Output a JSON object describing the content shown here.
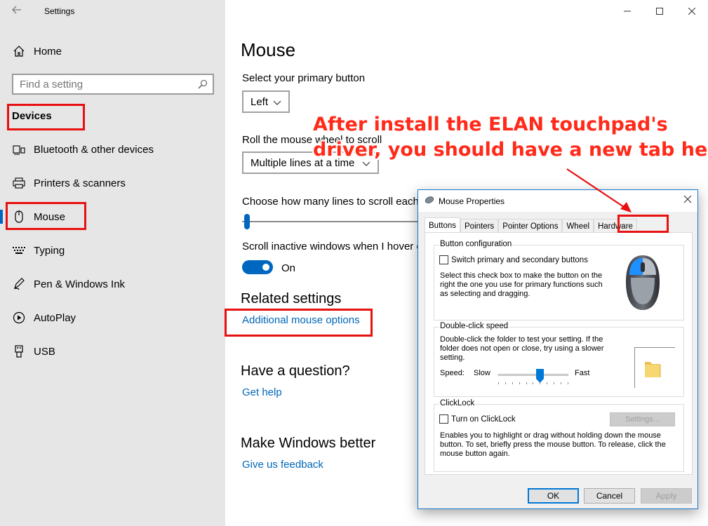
{
  "window": {
    "app_title": "Settings",
    "controls": [
      "minimize",
      "maximize",
      "close"
    ]
  },
  "sidebar": {
    "home_label": "Home",
    "search_placeholder": "Find a setting",
    "section_title": "Devices",
    "items": [
      {
        "label": "Bluetooth & other devices",
        "icon": "bluetooth-icon"
      },
      {
        "label": "Printers & scanners",
        "icon": "printer-icon"
      },
      {
        "label": "Mouse",
        "icon": "mouse-icon",
        "selected": true
      },
      {
        "label": "Typing",
        "icon": "keyboard-icon"
      },
      {
        "label": "Pen & Windows Ink",
        "icon": "pen-icon"
      },
      {
        "label": "AutoPlay",
        "icon": "autoplay-icon"
      },
      {
        "label": "USB",
        "icon": "usb-icon"
      }
    ]
  },
  "main": {
    "title": "Mouse",
    "primary_button_label": "Select your primary button",
    "primary_button_value": "Left",
    "scroll_label": "Roll the mouse wheel to scroll",
    "scroll_value": "Multiple lines at a time",
    "lines_label": "Choose how many lines to scroll each time",
    "inactive_label": "Scroll inactive windows when I hover over them",
    "toggle_state": "On",
    "related_title": "Related settings",
    "related_link": "Additional mouse options",
    "question_title": "Have a question?",
    "question_link": "Get help",
    "better_title": "Make Windows better",
    "better_link": "Give us feedback"
  },
  "annotation": {
    "line1": "After install the ELAN touchpad's",
    "line2": "driver, you should have a new tab here"
  },
  "dialog": {
    "title": "Mouse Properties",
    "tabs": [
      "Buttons",
      "Pointers",
      "Pointer Options",
      "Wheel",
      "Hardware"
    ],
    "active_tab": "Buttons",
    "button_config": {
      "title": "Button configuration",
      "checkbox_label": "Switch primary and secondary buttons",
      "desc_lines": [
        "Select this check box to make the button on the",
        "right the one you use for primary functions such",
        "as selecting and dragging."
      ]
    },
    "double_click": {
      "title": "Double-click speed",
      "desc_lines": [
        "Double-click the folder to test your setting. If the",
        "folder does not open or close, try using a slower",
        "setting."
      ],
      "speed_label": "Speed:",
      "slow_label": "Slow",
      "fast_label": "Fast"
    },
    "clicklock": {
      "title": "ClickLock",
      "checkbox_label": "Turn on ClickLock",
      "settings_button": "Settings...",
      "desc_lines": [
        "Enables you to highlight or drag without holding down the mouse",
        "button. To set, briefly press the mouse button. To release, click the",
        "mouse button again."
      ]
    },
    "buttons": {
      "ok": "OK",
      "cancel": "Cancel",
      "apply": "Apply"
    }
  },
  "colors": {
    "accent": "#0067c0",
    "link": "#0067b8",
    "highlight": "#e81010",
    "annotation": "#ff2a1a"
  }
}
